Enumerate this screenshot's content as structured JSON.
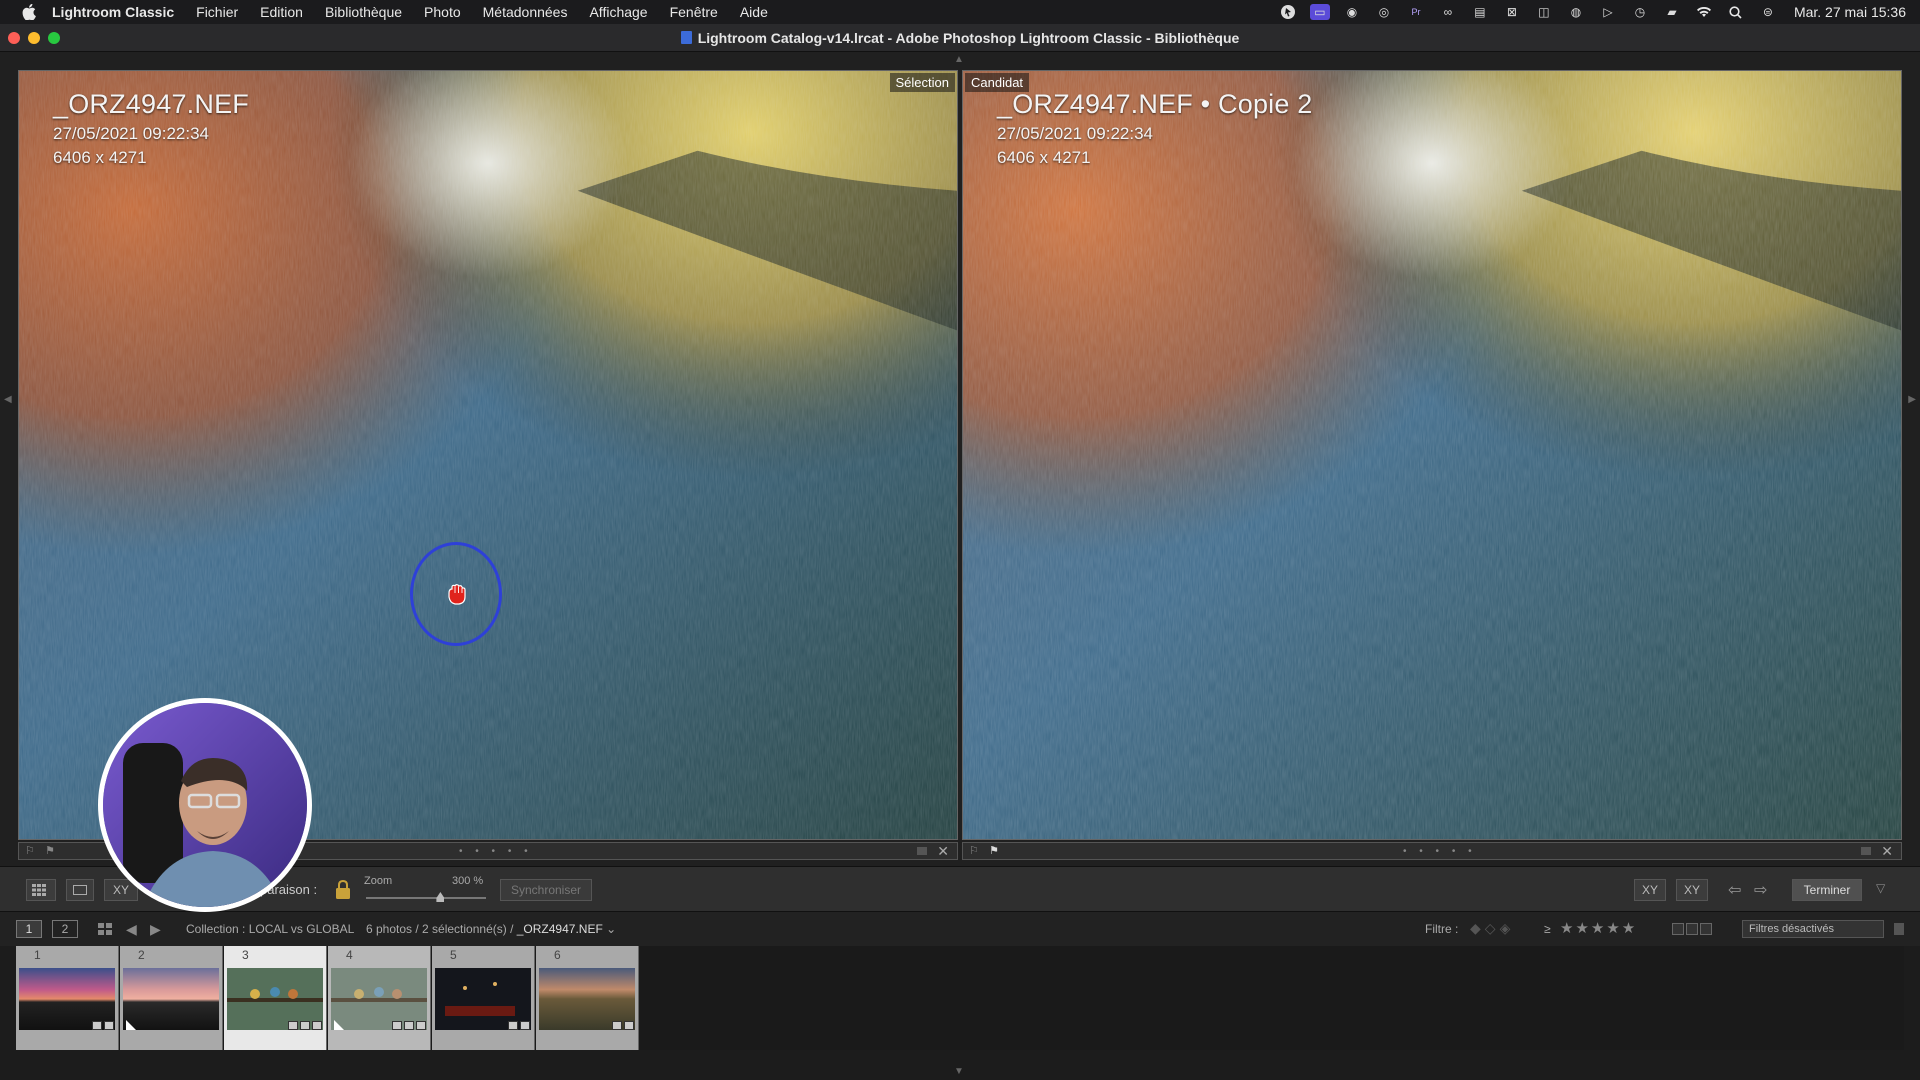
{
  "menubar": {
    "app_name": "Lightroom Classic",
    "items": [
      "Fichier",
      "Edition",
      "Bibliothèque",
      "Photo",
      "Métadonnées",
      "Affichage",
      "Fenêtre",
      "Aide"
    ],
    "clock": "Mar. 27 mai  15:36"
  },
  "window": {
    "title": "Lightroom Catalog-v14.lrcat - Adobe Photoshop Lightroom Classic - Bibliothèque"
  },
  "compare": {
    "left": {
      "tag": "Sélection",
      "filename": "_ORZ4947.NEF",
      "date": "27/05/2021 09:22:34",
      "dimensions": "6406 x 4271"
    },
    "right": {
      "tag": "Candidat",
      "filename": "_ORZ4947.NEF  •  Copie 2",
      "date": "27/05/2021 09:22:34",
      "dimensions": "6406 x 4271"
    },
    "footer_dots": "• • • • •"
  },
  "toolbar": {
    "grid_label": "",
    "compare_btn_label": "XY",
    "compare_label": "paraison :",
    "zoom_label": "Zoom",
    "zoom_value": "300 %",
    "zoom_fraction": 0.62,
    "sync_label": "Synchroniser",
    "swap_label": "XY",
    "swap2_label": "XY",
    "done_label": "Terminer"
  },
  "filmbar": {
    "screen1": "1",
    "screen2": "2",
    "collection": "Collection : LOCAL vs GLOBAL",
    "count": "6 photos / 2 sélectionné(s) / ",
    "current_photo": "_ORZ4947.NEF",
    "filter_label": "Filtre :",
    "filter_ge": "≥",
    "filter_stars": "★★★★★",
    "filter_select": "Filtres désactivés"
  },
  "filmstrip": [
    {
      "num": "1",
      "state": "normal"
    },
    {
      "num": "2",
      "state": "normal"
    },
    {
      "num": "3",
      "state": "selected"
    },
    {
      "num": "4",
      "state": "candidate"
    },
    {
      "num": "5",
      "state": "normal"
    },
    {
      "num": "6",
      "state": "normal"
    }
  ],
  "colors": {
    "accent": "#5b4bd8",
    "cursor_ring": "#2e40d8",
    "hand": "#e0231c"
  }
}
